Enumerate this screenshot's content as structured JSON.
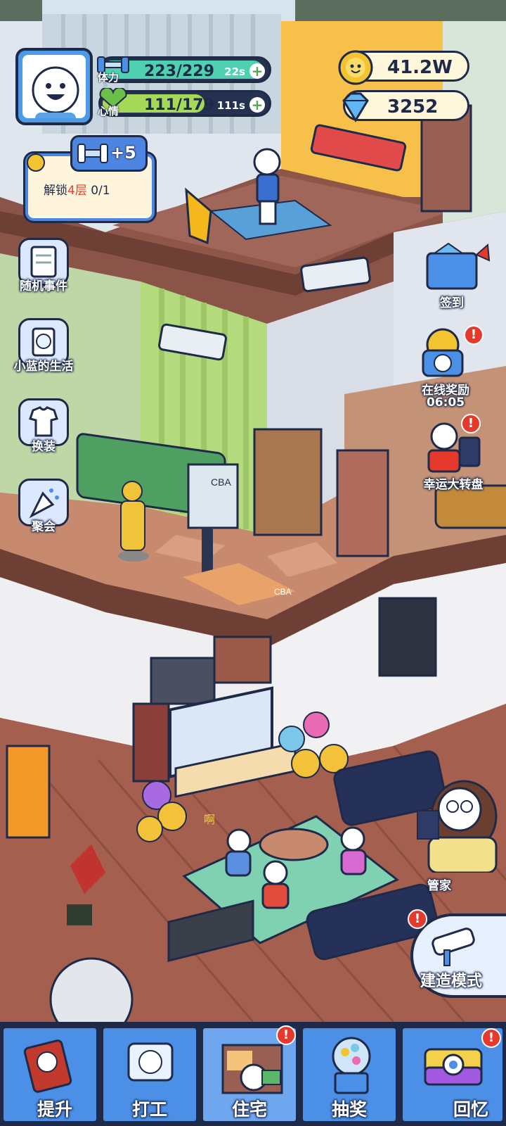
{
  "hud": {
    "stamina": {
      "label": "体力",
      "value": "223/229",
      "timer": "22s",
      "fill": 0.974
    },
    "mood": {
      "label": "心情",
      "value": "111/179",
      "timer": "111s",
      "fill": 0.62
    },
    "coins": "41.2W",
    "gems": "3252",
    "plus": "+"
  },
  "unlock_task": {
    "reward": "+5",
    "text_prefix": "解锁",
    "text_highlight": "4层",
    "progress": "0/1"
  },
  "left_menu": [
    {
      "label": "随机事件",
      "icon": "notebook-icon"
    },
    {
      "label": "小蓝的生活",
      "icon": "face-card-icon"
    },
    {
      "label": "换装",
      "icon": "shirt-icon"
    },
    {
      "label": "聚会",
      "icon": "party-popper-icon"
    }
  ],
  "right_menu": {
    "checkin": "签到",
    "online_reward": "在线奖励",
    "online_timer": "06:05",
    "lucky_wheel": "幸运大转盘",
    "butler": "管家",
    "build_mode": "建造模式",
    "alert": "!"
  },
  "scene": {
    "tv_text": "CBA",
    "court_text": "CBA",
    "tv_chars": "啊"
  },
  "nav": [
    {
      "label": "提升",
      "icon": "book-icon"
    },
    {
      "label": "打工",
      "icon": "work-tv-icon"
    },
    {
      "label": "住宅",
      "icon": "house-icon",
      "active": true,
      "alert": "!"
    },
    {
      "label": "抽奖",
      "icon": "gacha-machine-icon"
    },
    {
      "label": "回忆",
      "icon": "camera-icon",
      "alert": "!"
    }
  ],
  "colors": {
    "outline": "#1e2a48",
    "stamina": "#4fd1b0",
    "mood": "#a6d85a",
    "ui_blue": "#4b8fe6",
    "alert_red": "#e53a2b"
  }
}
